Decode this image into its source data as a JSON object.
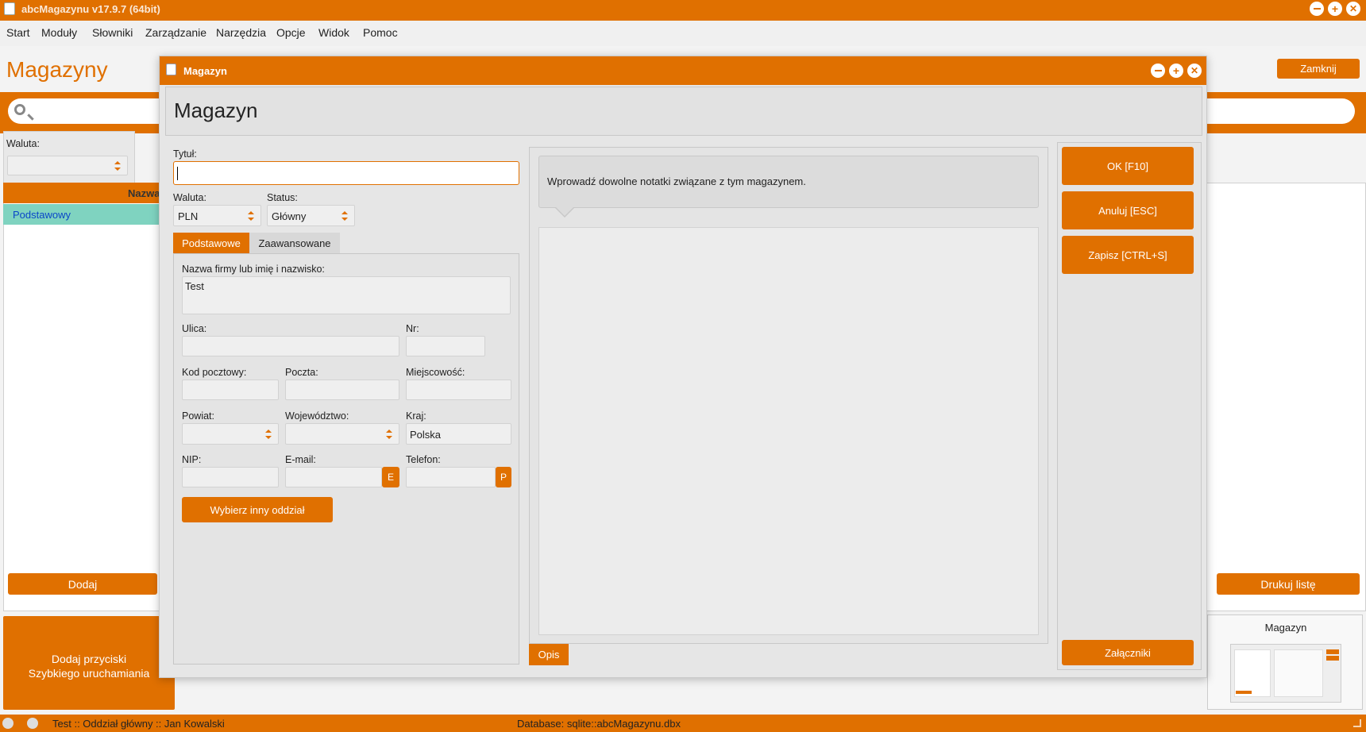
{
  "app": {
    "title": "abcMagazynu v17.9.7 (64bit)"
  },
  "menu": [
    "Start",
    "Moduły",
    "Słowniki",
    "Zarządzanie",
    "Narzędzia",
    "Opcje",
    "Widok",
    "Pomoc"
  ],
  "bg": {
    "page_title": "Magazyny",
    "close_label": "Zamknij",
    "waluta_label": "Waluta:",
    "column_header": "Nazwa",
    "row": "Podstawowy",
    "add_label": "Dodaj",
    "print_label": "Drukuj listę",
    "quick_launch_line1": "Dodaj przyciski",
    "quick_launch_line2": "Szybkiego uruchamiania",
    "thumbnail_title": "Magazyn"
  },
  "dialog": {
    "window_title": "Magazyn",
    "heading": "Magazyn",
    "title_label": "Tytuł:",
    "title_value": "",
    "waluta_label": "Waluta:",
    "waluta_value": "PLN",
    "status_label": "Status:",
    "status_value": "Główny",
    "tabs": [
      "Podstawowe",
      "Zaawansowane"
    ],
    "company_label": "Nazwa firmy lub imię i nazwisko:",
    "company_value": "Test",
    "street_label": "Ulica:",
    "nr_label": "Nr:",
    "postal_label": "Kod pocztowy:",
    "post_label": "Poczta:",
    "city_label": "Miejscowość:",
    "county_label": "Powiat:",
    "voivodeship_label": "Województwo:",
    "country_label": "Kraj:",
    "country_value": "Polska",
    "nip_label": "NIP:",
    "email_label": "E-mail:",
    "email_btn": "E",
    "phone_label": "Telefon:",
    "phone_btn": "P",
    "branch_btn": "Wybierz inny oddział",
    "notes_hint": "Wprowadź dowolne notatki związane z tym magazynem.",
    "opis_tab": "Opis",
    "ok_label": "OK [F10]",
    "cancel_label": "Anuluj [ESC]",
    "save_label": "Zapisz [CTRL+S]",
    "attachments_label": "Załączniki"
  },
  "statusbar": {
    "left": "Test :: Oddział główny :: Jan Kowalski",
    "database": "Database: sqlite::abcMagazynu.dbx"
  },
  "colors": {
    "accent": "#e07000",
    "selected_row": "#7fd3c0"
  }
}
